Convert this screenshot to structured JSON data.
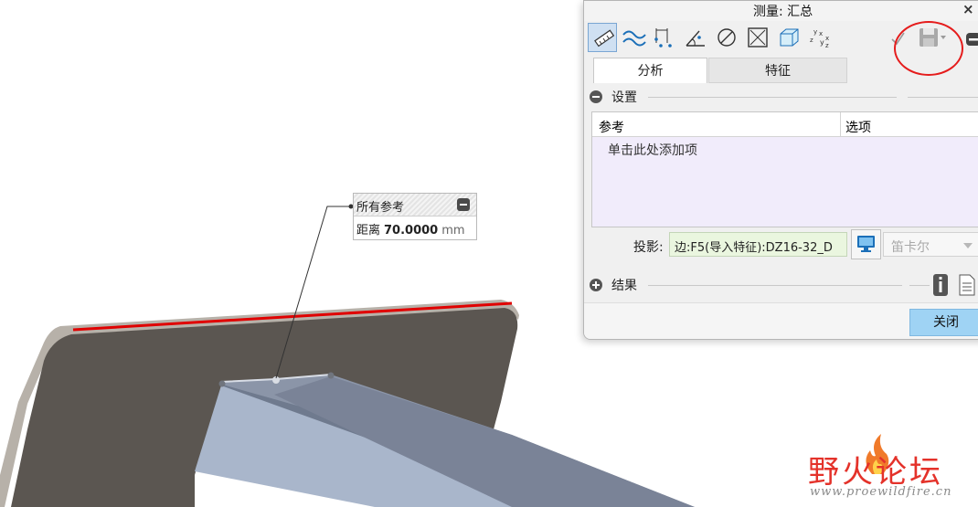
{
  "dialog": {
    "title": "测量: 汇总",
    "close_glyph": "×",
    "toolbar_tools": [
      "ruler-icon",
      "curve-length-icon",
      "distance-icon",
      "angle-icon",
      "diameter-icon",
      "area-icon",
      "volume-icon",
      "transform-icon"
    ],
    "tabs": [
      {
        "label": "分析",
        "active": true
      },
      {
        "label": "特征",
        "active": false
      }
    ],
    "settings_label": "设置",
    "table_headers": [
      "参考",
      "选项"
    ],
    "table_hint": "单击此处添加项",
    "projection_label": "投影:",
    "projection_value": "边:F5(导入特征):DZ16-32_D",
    "coord_system": "笛卡尔",
    "results_label": "结果",
    "close_button": "关闭"
  },
  "callout": {
    "header": "所有参考",
    "label": "距离",
    "value": "70.0000",
    "unit": "mm"
  },
  "watermark": {
    "text": "野火论坛",
    "url": "www.proewildfire.cn"
  },
  "colors": {
    "selected_edge": "#e00000",
    "plate": "#5b5651",
    "beam": "#a7b3c7",
    "annotation_circle": "#e51c1c",
    "close_button": "#9fd3f4"
  }
}
